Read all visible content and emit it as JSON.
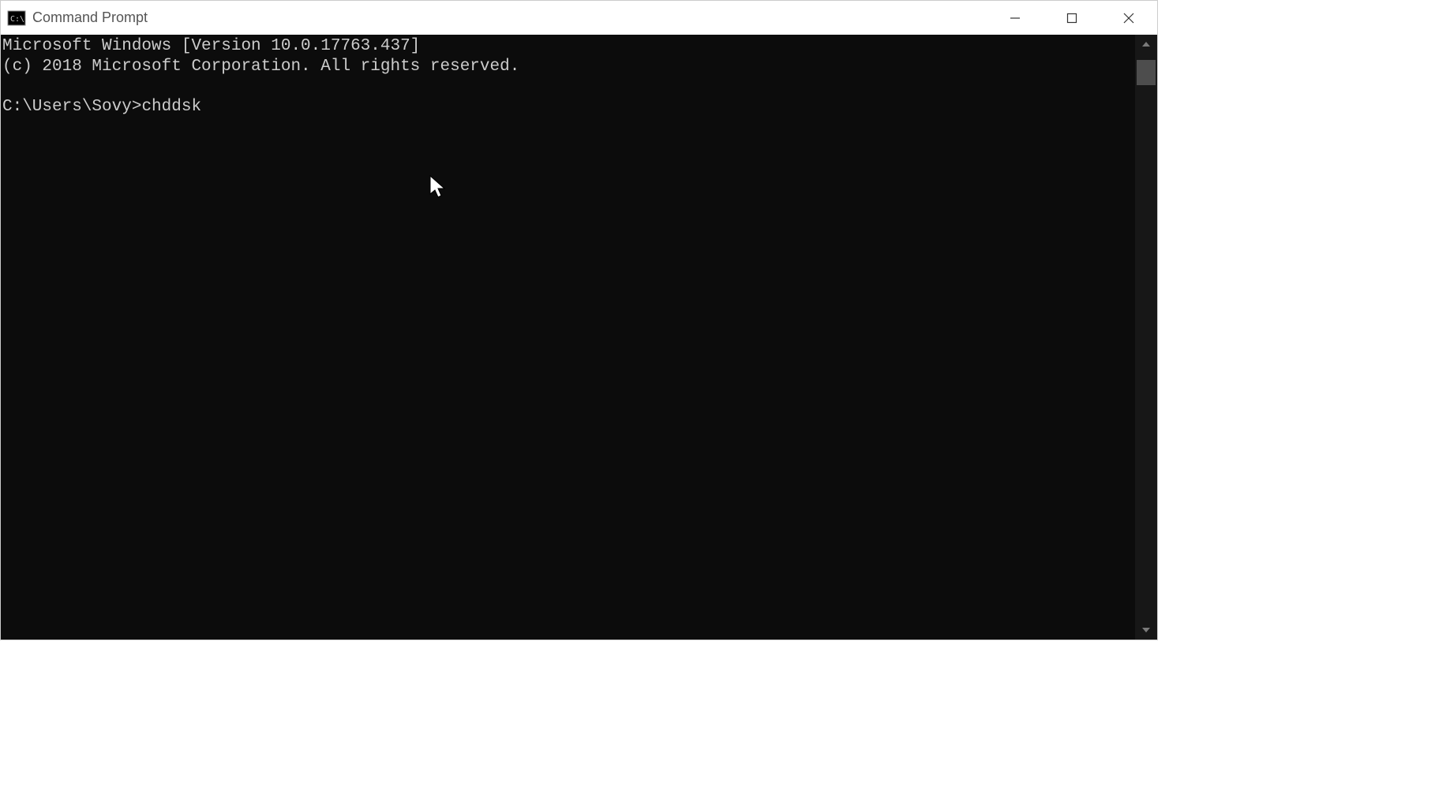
{
  "window": {
    "title": "Command Prompt"
  },
  "terminal": {
    "line1": "Microsoft Windows [Version 10.0.17763.437]",
    "line2": "(c) 2018 Microsoft Corporation. All rights reserved.",
    "blank": "",
    "prompt": "C:\\Users\\Sovy>",
    "command": "chddsk"
  }
}
